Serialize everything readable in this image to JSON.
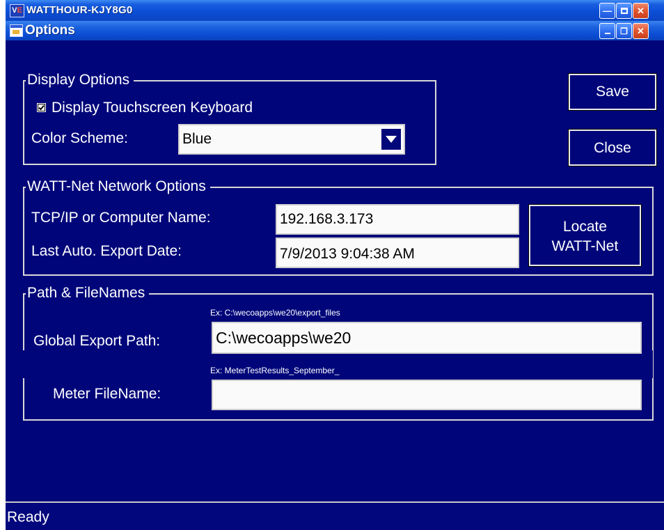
{
  "app_window": {
    "title": "WATTHOUR-KJY8G0",
    "icon_text": "VE",
    "controls": [
      "minimize-icon",
      "maximize-icon",
      "close-icon"
    ]
  },
  "options_window": {
    "title": "Options",
    "controls": [
      "minimize-icon",
      "restore-icon",
      "close-icon"
    ]
  },
  "display_options": {
    "legend": "Display Options",
    "touch_keyboard_label": "Display Touchscreen Keyboard",
    "touch_keyboard_checked": true,
    "color_scheme_label": "Color Scheme:",
    "color_scheme_value": "Blue"
  },
  "actions": {
    "save_label": "Save",
    "close_label": "Close"
  },
  "network_options": {
    "legend": "WATT-Net Network Options",
    "tcpip_label": "TCP/IP or Computer Name:",
    "tcpip_value": "192.168.3.173",
    "export_date_label": "Last Auto. Export Date:",
    "export_date_value": "7/9/2013 9:04:38 AM",
    "locate_label_line1": "Locate",
    "locate_label_line2": "WATT-Net"
  },
  "paths": {
    "legend": "Path & FileNames",
    "export_path_hint": "Ex:   C:\\wecoapps\\we20\\export_files",
    "export_path_label": "Global Export Path:",
    "export_path_value": "C:\\wecoapps\\we20",
    "filename_hint": "Ex:   MeterTestResults_September_",
    "filename_label": "Meter FileName:",
    "filename_value": ""
  },
  "status": {
    "text": "Ready"
  },
  "colors": {
    "background": "#00067a",
    "title_bar": "#0a4ed6",
    "close_button": "#e0552f"
  }
}
